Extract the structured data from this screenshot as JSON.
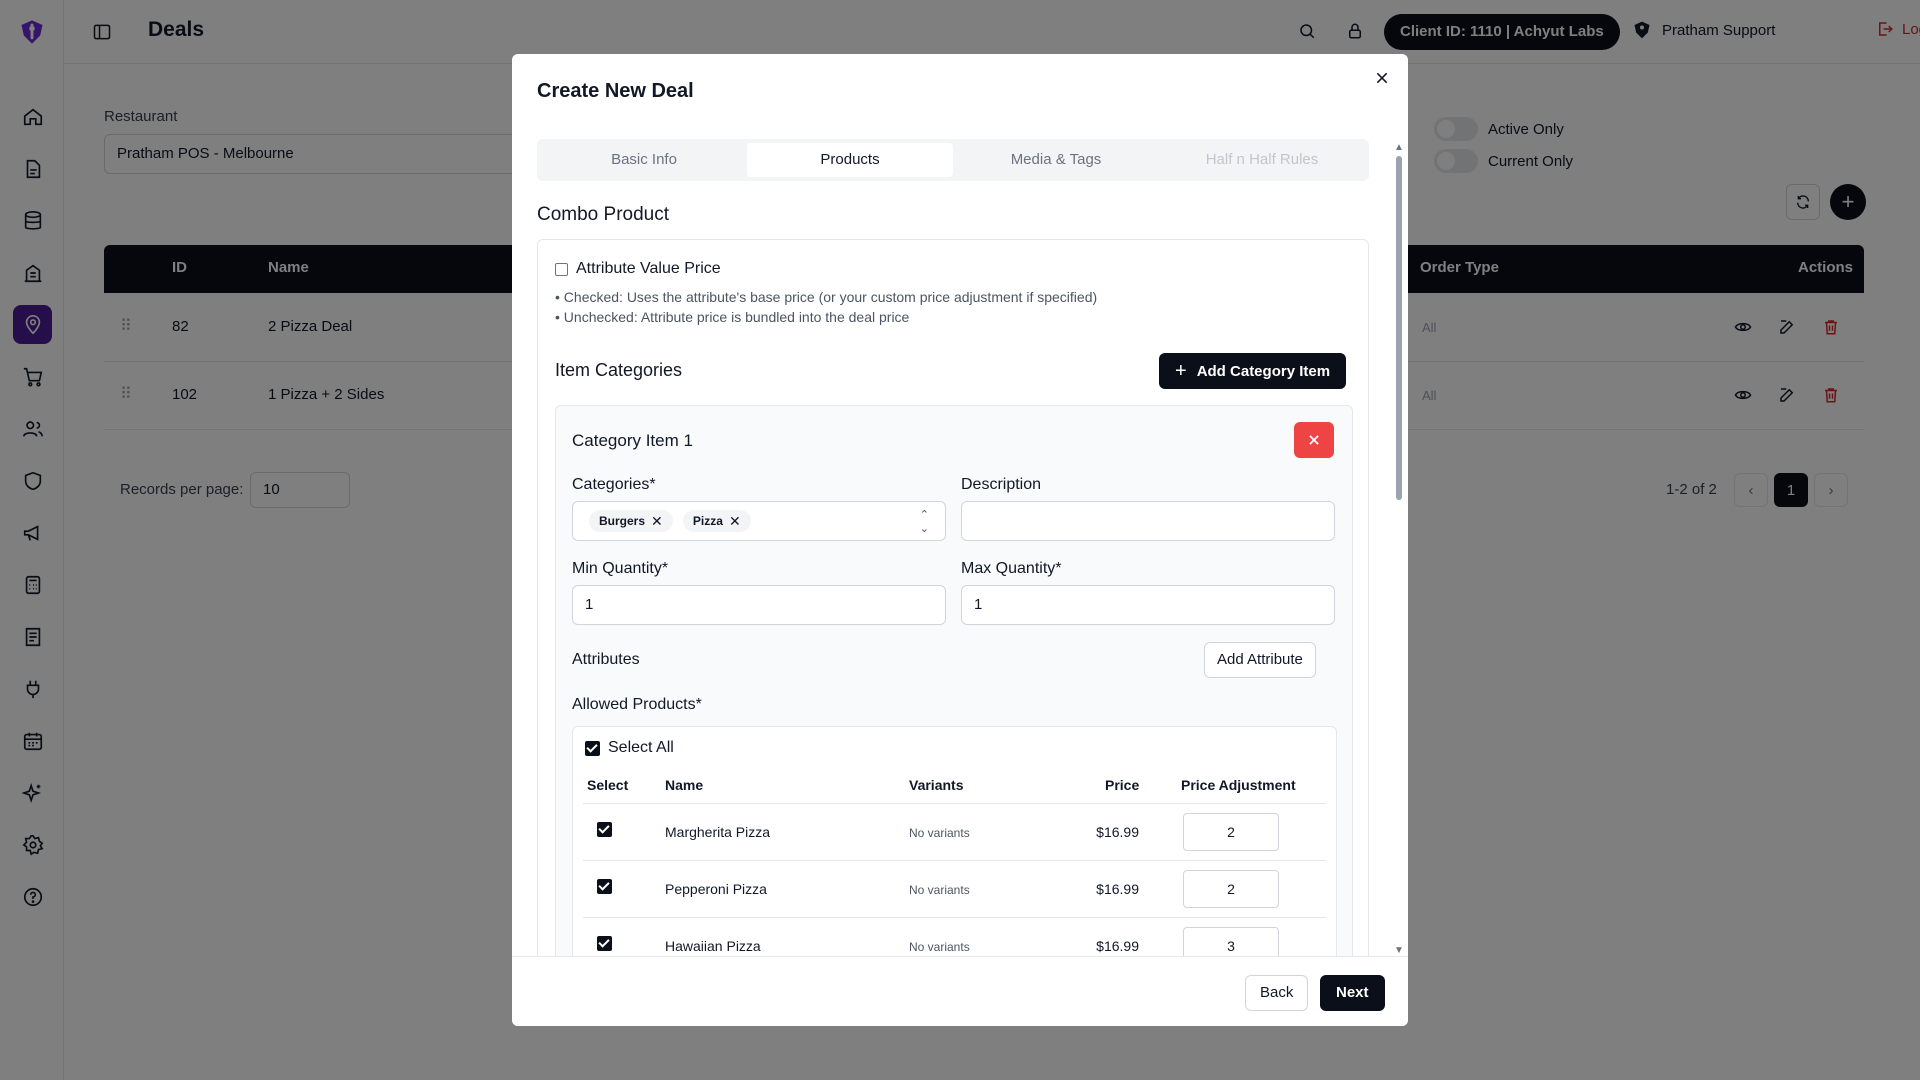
{
  "header": {
    "title": "Deals",
    "client_pill": "Client ID: 1110 | Achyut Labs",
    "support_user": "Pratham Support",
    "logout_label": "Logout"
  },
  "sidebar": {
    "items": [
      {
        "icon": "home-icon"
      },
      {
        "icon": "document-icon"
      },
      {
        "icon": "database-icon"
      },
      {
        "icon": "building-icon"
      },
      {
        "icon": "location-pin-icon",
        "active": true
      },
      {
        "icon": "cart-icon"
      },
      {
        "icon": "users-icon"
      },
      {
        "icon": "shield-icon"
      },
      {
        "icon": "megaphone-icon"
      },
      {
        "icon": "calculator-icon"
      },
      {
        "icon": "receipt-icon"
      },
      {
        "icon": "plug-icon"
      },
      {
        "icon": "calendar-icon"
      },
      {
        "icon": "sparkles-icon"
      },
      {
        "icon": "gear-icon"
      },
      {
        "icon": "help-icon"
      }
    ]
  },
  "filters": {
    "restaurant_label": "Restaurant",
    "restaurant_value": "Pratham POS - Melbourne",
    "active_only_label": "Active Only",
    "current_only_label": "Current Only"
  },
  "table": {
    "headers": {
      "id": "ID",
      "name": "Name",
      "order_type": "Order Type",
      "actions": "Actions"
    },
    "rows": [
      {
        "id": "82",
        "name": "2 Pizza Deal",
        "order_type": "All"
      },
      {
        "id": "102",
        "name": "1 Pizza + 2 Sides",
        "order_type": "All"
      }
    ]
  },
  "pagination": {
    "records_label": "Records per page:",
    "records_value": "10",
    "range_text": "1-2 of 2",
    "current_page": "1"
  },
  "modal": {
    "title": "Create New Deal",
    "tabs": [
      {
        "label": "Basic Info",
        "state": "normal"
      },
      {
        "label": "Products",
        "state": "active"
      },
      {
        "label": "Media & Tags",
        "state": "normal"
      },
      {
        "label": "Half n Half Rules",
        "state": "disabled"
      }
    ],
    "section_title": "Combo Product",
    "attribute_value_price_label": "Attribute Value Price",
    "attribute_value_price_checked": false,
    "note_checked": "• Checked: Uses the attribute's base price (or your custom price adjustment if specified)",
    "note_unchecked": "• Unchecked: Attribute price is bundled into the deal price",
    "item_categories_title": "Item Categories",
    "add_category_item_label": "Add Category Item",
    "category_item": {
      "title": "Category Item 1",
      "categories_label": "Categories*",
      "categories": [
        "Burgers",
        "Pizza"
      ],
      "description_label": "Description",
      "description_value": "",
      "min_quantity_label": "Min Quantity*",
      "min_quantity_value": "1",
      "max_quantity_label": "Max Quantity*",
      "max_quantity_value": "1",
      "attributes_label": "Attributes",
      "add_attribute_label": "Add Attribute",
      "allowed_products_label": "Allowed Products*",
      "select_all_label": "Select All",
      "product_headers": {
        "select": "Select",
        "name": "Name",
        "variants": "Variants",
        "price": "Price",
        "price_adjustment": "Price Adjustment"
      },
      "products": [
        {
          "name": "Margherita Pizza",
          "variants": "No variants",
          "price": "$16.99",
          "adjustment": "2",
          "checked": true
        },
        {
          "name": "Pepperoni Pizza",
          "variants": "No variants",
          "price": "$16.99",
          "adjustment": "2",
          "checked": true
        },
        {
          "name": "Hawaiian Pizza",
          "variants": "No variants",
          "price": "$16.99",
          "adjustment": "3",
          "checked": true
        }
      ]
    },
    "back_label": "Back",
    "next_label": "Next"
  },
  "colors": {
    "primary_dark": "#0b0f19",
    "brand_purple": "#4c1d95",
    "danger": "#ef4444",
    "logout_red": "#dc2626"
  }
}
